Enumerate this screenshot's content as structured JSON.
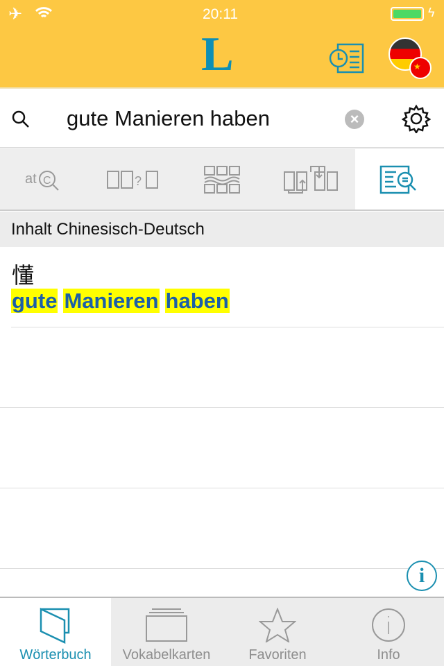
{
  "status": {
    "time": "20:11"
  },
  "header": {
    "logo": "L",
    "history_icon": "history-icon",
    "language_icon": "german-chinese-flags"
  },
  "search": {
    "value": "gute Manieren haben",
    "placeholder": ""
  },
  "tabs": [
    {
      "name": "spelling-search"
    },
    {
      "name": "wildcard-search"
    },
    {
      "name": "fuzzy-search"
    },
    {
      "name": "translate-direction"
    },
    {
      "name": "fulltext-search",
      "active": true
    }
  ],
  "section": {
    "title": "Inhalt Chinesisch-Deutsch"
  },
  "results": [
    {
      "headword": "懂",
      "words": [
        "gute",
        "Manieren",
        "haben"
      ]
    }
  ],
  "colors": {
    "accent": "#1a8fb0",
    "header": "#fdc843",
    "highlight": "#ffff00"
  },
  "tabbar": [
    {
      "label": "Wörterbuch",
      "active": true
    },
    {
      "label": "Vokabelkarten"
    },
    {
      "label": "Favoriten"
    },
    {
      "label": "Info"
    }
  ]
}
